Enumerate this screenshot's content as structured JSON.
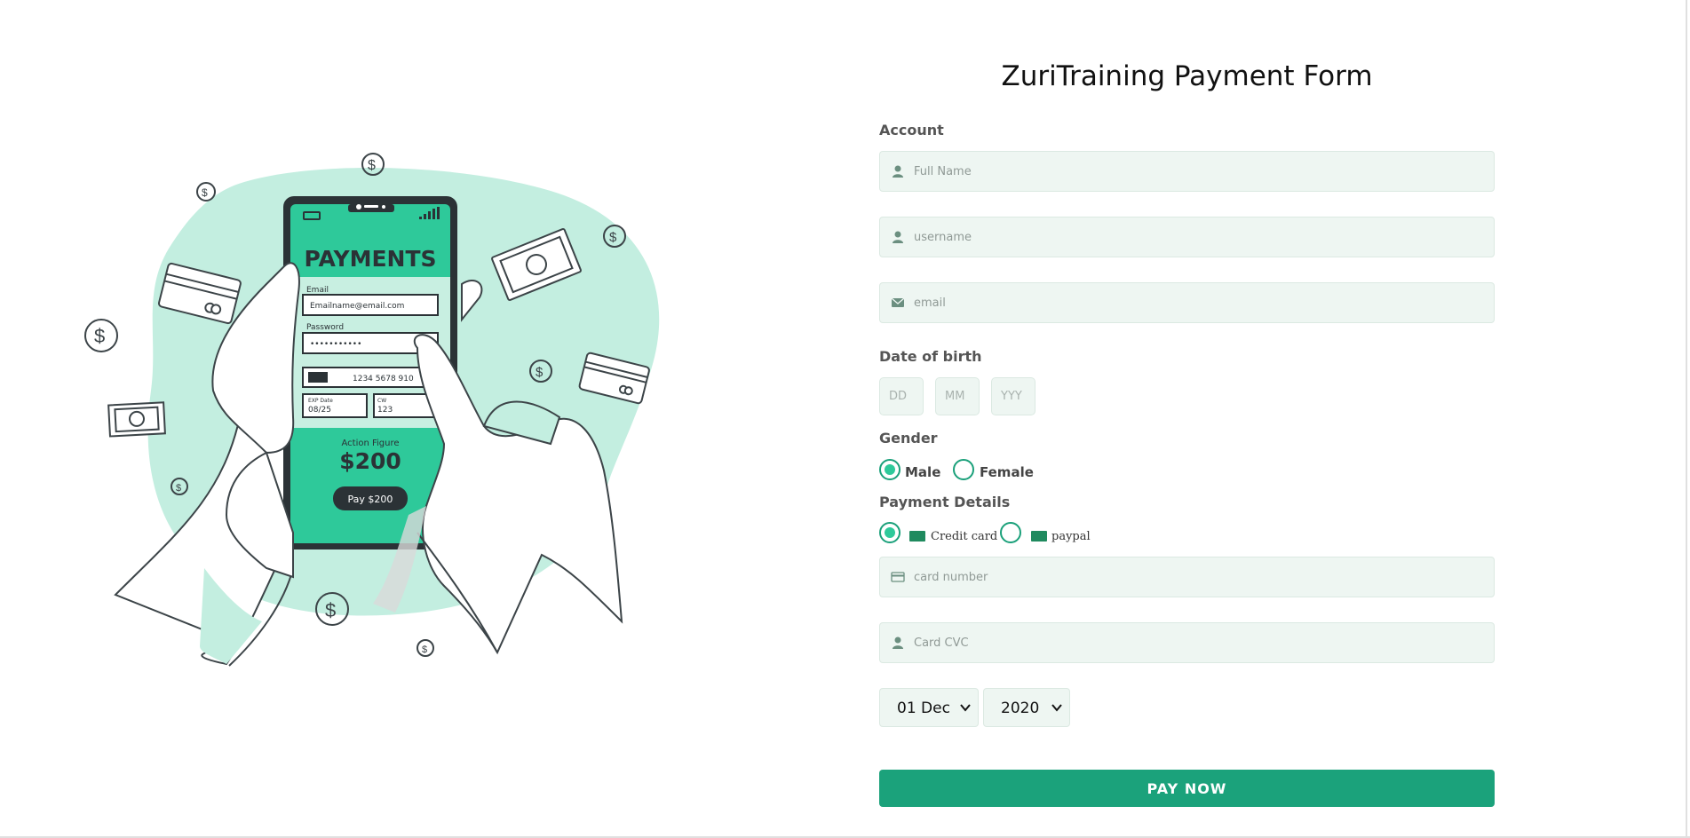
{
  "page": {
    "title": "ZuriTraining Payment Form"
  },
  "illustration": {
    "screen_title": "PAYMENTS",
    "email_label": "Email",
    "email_value": "Emailname@email.com",
    "password_label": "Password",
    "password_value": "•••••••••••",
    "card_number": "1234 5678 910",
    "exp_label": "EXP Date",
    "exp_value": "08/25",
    "cvv_label": "CW",
    "cvv_value": "123",
    "item_label": "Action Figure",
    "price": "$200",
    "pay_button": "Pay $200",
    "colors": {
      "accent": "#2ec99a",
      "blob": "#c3eee0",
      "dark": "#2b3236"
    }
  },
  "form": {
    "account_label": "Account",
    "full_name_placeholder": "Full Name",
    "username_placeholder": "username",
    "email_placeholder": "email",
    "dob_label": "Date of birth",
    "dob_day_placeholder": "DD",
    "dob_month_placeholder": "MM",
    "dob_year_placeholder": "YYY",
    "gender_label": "Gender",
    "gender_options": [
      "Male",
      "Female"
    ],
    "gender_selected": "Male",
    "payment_label": "Payment Details",
    "payment_options": [
      "Credit card",
      "paypal"
    ],
    "payment_selected": "Credit card",
    "card_number_placeholder": "card number",
    "card_cvc_placeholder": "Card CVC",
    "expiry_day_selected": "01 Dec",
    "expiry_year_selected": "2020",
    "pay_button_label": "PAY NOW",
    "icons": {
      "full_name": "user-icon",
      "username": "user-icon",
      "email": "envelope-icon",
      "card_number": "credit-card-icon",
      "card_cvc": "user-icon",
      "credit_card_badge": "visa-icon",
      "paypal_badge": "paypal-icon",
      "select_arrow": "chevron-down-icon"
    },
    "colors": {
      "accent": "#1ba27b",
      "field_bg": "#eef6f2",
      "radio": "#2ec99a"
    }
  }
}
